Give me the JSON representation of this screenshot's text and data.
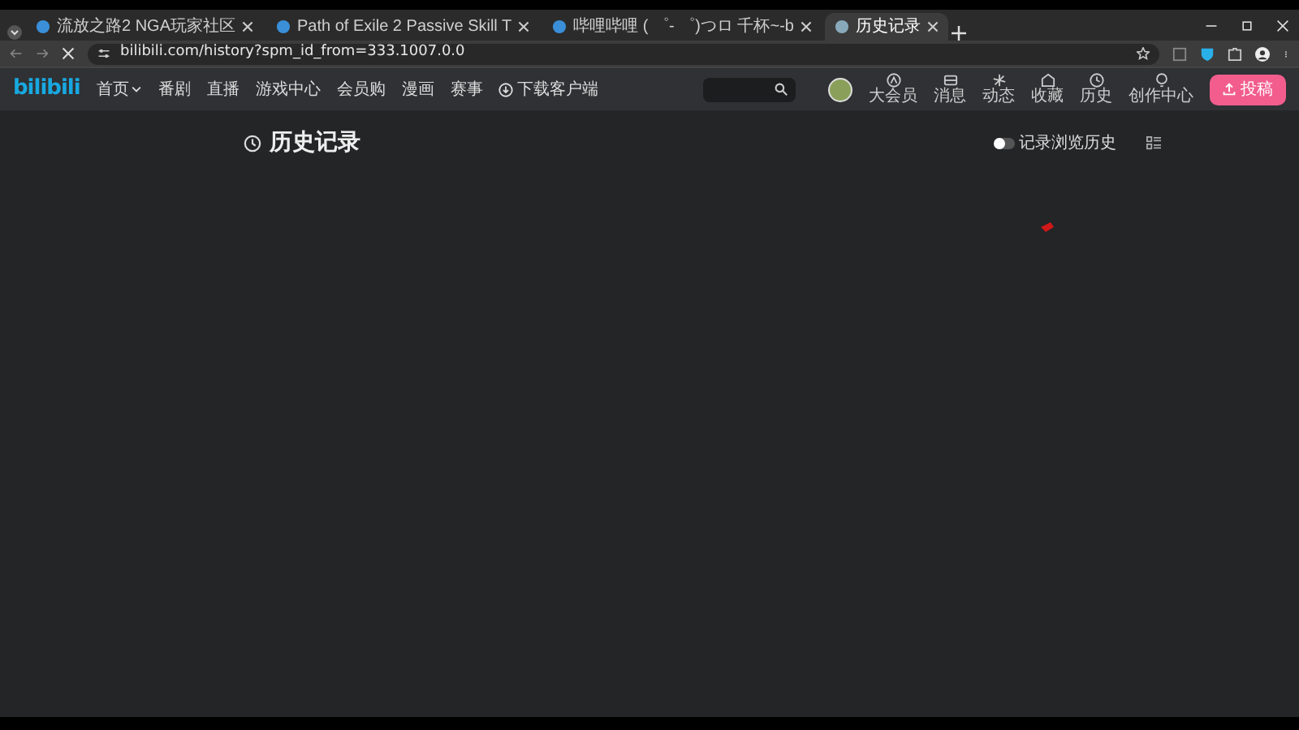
{
  "browser": {
    "tabs": [
      {
        "title": "流放之路2 NGA玩家社区",
        "selected": false
      },
      {
        "title": "Path of Exile 2 Passive Skill T",
        "selected": false
      },
      {
        "title": "哔哩哔哩 ( ゜- ゜)つロ 千杯~-b",
        "selected": false
      },
      {
        "title": "历史记录",
        "selected": true
      }
    ],
    "url": "bilibili.com/history?spm_id_from=333.1007.0.0"
  },
  "header": {
    "logo": "bilibili",
    "nav": [
      {
        "label": "首页",
        "kind": "dropdown"
      },
      {
        "label": "番剧",
        "kind": "link"
      },
      {
        "label": "直播",
        "kind": "link"
      },
      {
        "label": "游戏中心",
        "kind": "link"
      },
      {
        "label": "会员购",
        "kind": "link"
      },
      {
        "label": "漫画",
        "kind": "link"
      },
      {
        "label": "赛事",
        "kind": "link"
      },
      {
        "label": "下载客户端",
        "kind": "download"
      }
    ],
    "actions": [
      {
        "label": "大会员"
      },
      {
        "label": "消息"
      },
      {
        "label": "动态"
      },
      {
        "label": "收藏"
      },
      {
        "label": "历史"
      },
      {
        "label": "创作中心"
      }
    ],
    "upload_button": "投稿"
  },
  "page": {
    "title": "历史记录",
    "record_toggle": {
      "label": "记录浏览历史",
      "on": false
    }
  }
}
